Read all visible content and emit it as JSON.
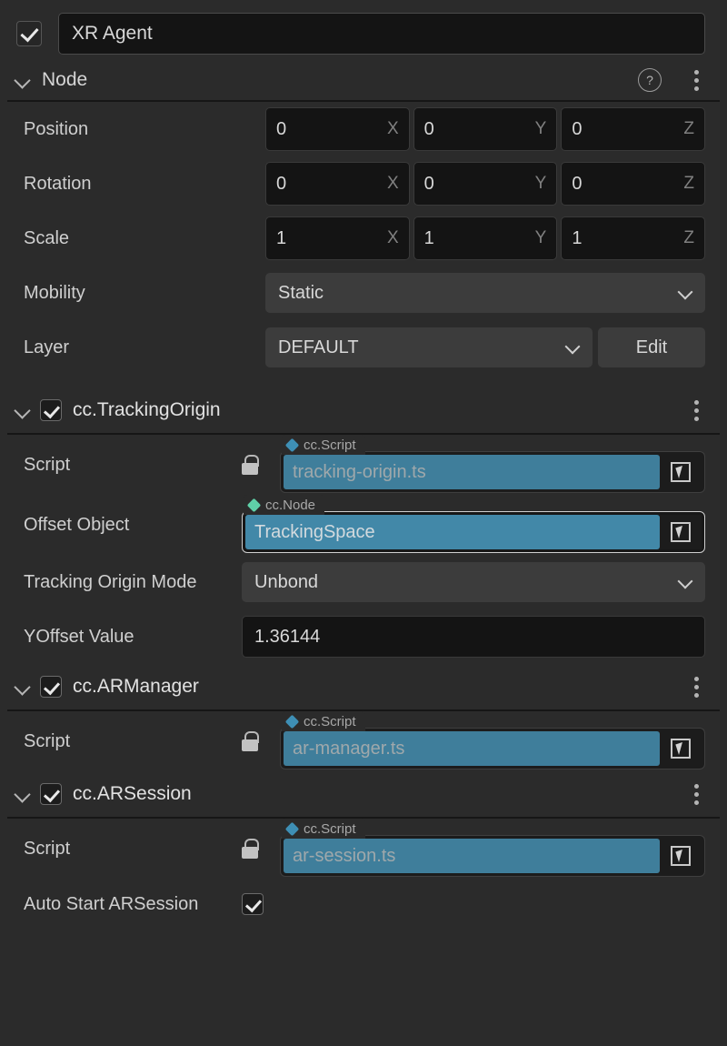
{
  "node": {
    "enabled_checkbox": "checked",
    "name_value": "XR Agent",
    "section_title": "Node",
    "help_icon": "question-circle-icon",
    "menu_icon": "kebab-menu-icon",
    "properties": {
      "position": {
        "label": "Position",
        "x": "0",
        "y": "0",
        "z": "0"
      },
      "rotation": {
        "label": "Rotation",
        "x": "0",
        "y": "0",
        "z": "0"
      },
      "scale": {
        "label": "Scale",
        "x": "1",
        "y": "1",
        "z": "1"
      },
      "mobility": {
        "label": "Mobility",
        "value": "Static"
      },
      "layer": {
        "label": "Layer",
        "value": "DEFAULT",
        "edit_label": "Edit"
      }
    },
    "axis_labels": {
      "x": "X",
      "y": "Y",
      "z": "Z"
    }
  },
  "components": [
    {
      "title": "cc.TrackingOrigin",
      "enabled": "checked",
      "rows": [
        {
          "kind": "ref",
          "label": "Script",
          "locked": true,
          "tag": "cc.Script",
          "tag_color": "#3e8fb5",
          "value": "tracking-origin.ts",
          "focused": false
        },
        {
          "kind": "ref",
          "label": "Offset Object",
          "locked": false,
          "tag": "cc.Node",
          "tag_color": "#5fd1a8",
          "value": "TrackingSpace",
          "focused": true
        },
        {
          "kind": "dropdown",
          "label": "Tracking Origin Mode",
          "value": "Unbond"
        },
        {
          "kind": "text",
          "label": "YOffset Value",
          "value": "1.36144"
        }
      ]
    },
    {
      "title": "cc.ARManager",
      "enabled": "checked",
      "rows": [
        {
          "kind": "ref",
          "label": "Script",
          "locked": true,
          "tag": "cc.Script",
          "tag_color": "#3e8fb5",
          "value": "ar-manager.ts",
          "focused": false
        }
      ]
    },
    {
      "title": "cc.ARSession",
      "enabled": "checked",
      "rows": [
        {
          "kind": "ref",
          "label": "Script",
          "locked": true,
          "tag": "cc.Script",
          "tag_color": "#3e8fb5",
          "value": "ar-session.ts",
          "focused": false
        },
        {
          "kind": "checkbox",
          "label": "Auto Start ARSession",
          "value": "checked"
        }
      ]
    }
  ],
  "icons": {
    "chevron_down": "chevron-down-icon",
    "lock": "lock-icon",
    "pick": "node-picker-icon",
    "diamond": "asset-type-diamond-icon"
  }
}
